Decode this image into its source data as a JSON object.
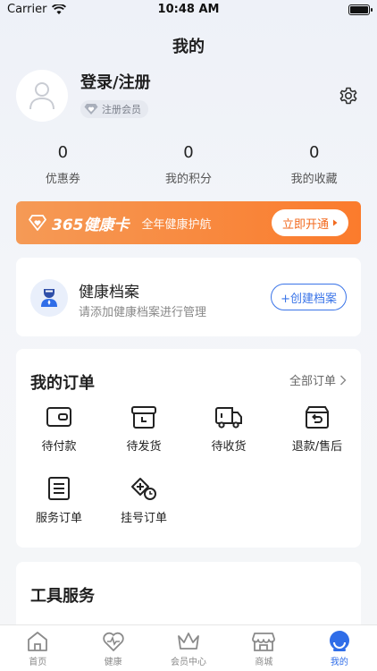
{
  "status": {
    "carrier": "Carrier",
    "time": "10:48 AM"
  },
  "page": {
    "title": "我的"
  },
  "profile": {
    "login_label": "登录/注册",
    "member_label": "注册会员"
  },
  "stats": [
    {
      "value": "0",
      "label": "优惠券"
    },
    {
      "value": "0",
      "label": "我的积分"
    },
    {
      "value": "0",
      "label": "我的收藏"
    }
  ],
  "banner": {
    "title": "365健康卡",
    "subtitle": "全年健康护航",
    "button": "立即开通"
  },
  "records": {
    "title": "健康档案",
    "subtitle": "请添加健康档案进行管理",
    "button": "+创建档案"
  },
  "orders": {
    "title": "我的订单",
    "all_label": "全部订单",
    "items": [
      {
        "label": "待付款",
        "icon": "wallet-icon"
      },
      {
        "label": "待发货",
        "icon": "box-icon"
      },
      {
        "label": "待收货",
        "icon": "truck-icon"
      },
      {
        "label": "退款/售后",
        "icon": "refund-icon"
      },
      {
        "label": "服务订单",
        "icon": "document-icon"
      },
      {
        "label": "挂号订单",
        "icon": "registration-icon"
      }
    ]
  },
  "tools": {
    "title": "工具服务"
  },
  "tabbar": {
    "items": [
      {
        "label": "首页",
        "icon": "home-icon"
      },
      {
        "label": "健康",
        "icon": "heart-pulse-icon"
      },
      {
        "label": "会员中心",
        "icon": "crown-icon"
      },
      {
        "label": "商城",
        "icon": "store-icon"
      },
      {
        "label": "我的",
        "icon": "profile-icon"
      }
    ],
    "active_index": 4
  },
  "colors": {
    "accent": "#2f6de8",
    "banner_start": "#f59a56",
    "banner_end": "#fb7b2c"
  }
}
